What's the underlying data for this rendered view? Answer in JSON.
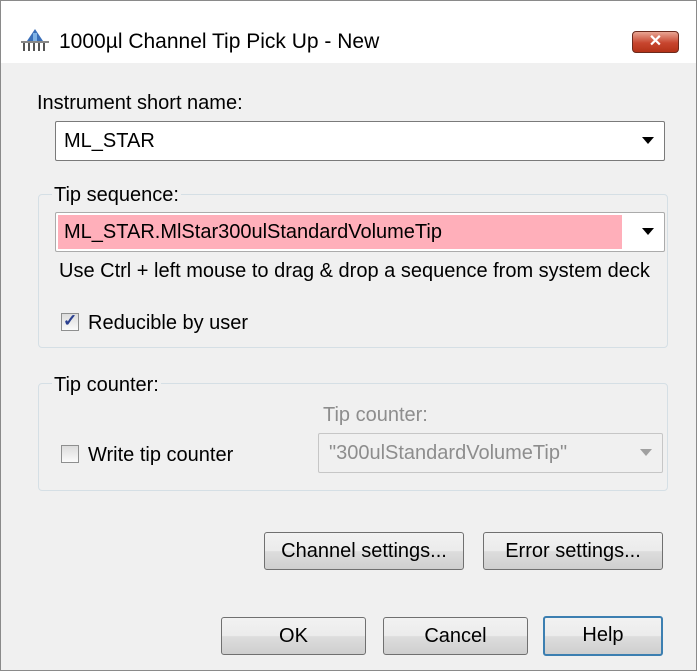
{
  "window": {
    "title": "1000µl Channel Tip Pick Up - New",
    "close_label": "✕"
  },
  "instrument": {
    "label": "Instrument short name:",
    "value": "ML_STAR"
  },
  "tip_sequence": {
    "group_label": "Tip sequence:",
    "value": "ML_STAR.MlStar300ulStandardVolumeTip",
    "highlight_color": "#ffafba",
    "hint": "Use Ctrl + left mouse to drag & drop a sequence from system deck",
    "reducible_label": "Reducible by user",
    "reducible_checked": true
  },
  "tip_counter": {
    "group_label": "Tip counter:",
    "write_label": "Write tip counter",
    "write_checked": false,
    "field_label": "Tip counter:",
    "field_value": "\"300ulStandardVolumeTip\""
  },
  "buttons": {
    "channel_settings": "Channel settings...",
    "error_settings": "Error settings...",
    "ok": "OK",
    "cancel": "Cancel",
    "help": "Help"
  }
}
